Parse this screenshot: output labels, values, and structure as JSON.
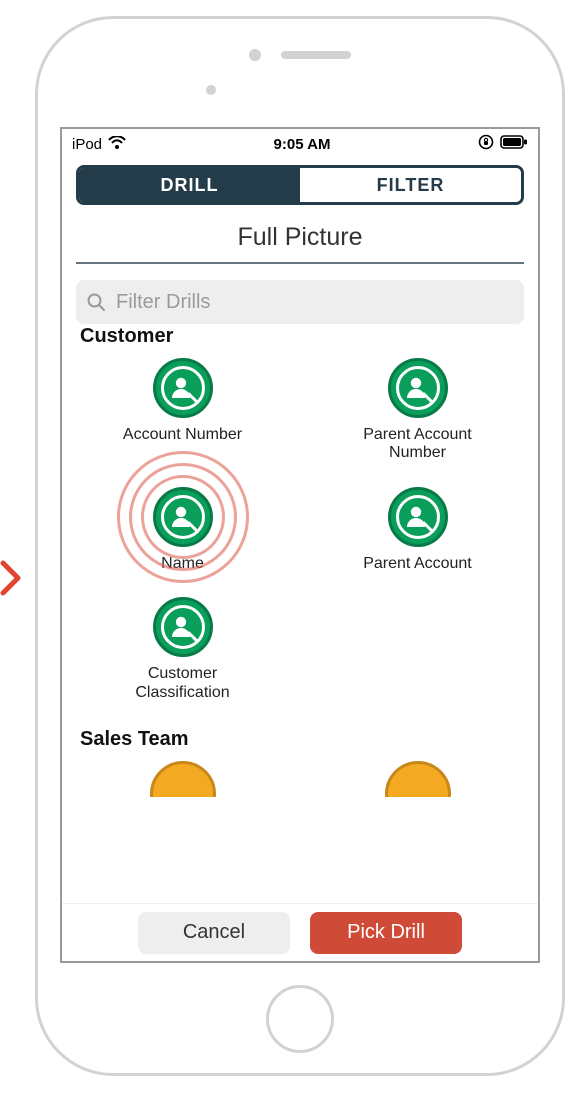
{
  "colors": {
    "dark_navy": "#243b4a",
    "accent_red": "#cf4b37",
    "customer_green": "#0a9e5b",
    "sales_orange": "#f3a922"
  },
  "statusbar": {
    "device": "iPod",
    "time": "9:05 AM"
  },
  "tabs": {
    "drill": "DRILL",
    "filter": "FILTER",
    "active": "drill"
  },
  "title": "Full Picture",
  "search": {
    "placeholder": "Filter Drills",
    "value": ""
  },
  "sections": {
    "customer": {
      "header": "Customer",
      "items": [
        {
          "id": "account-number",
          "label": "Account Number",
          "icon": "person-magnifier-icon",
          "highlighted": false
        },
        {
          "id": "parent-account-number",
          "label": "Parent Account Number",
          "icon": "person-magnifier-icon",
          "highlighted": false
        },
        {
          "id": "name",
          "label": "Name",
          "icon": "person-magnifier-icon",
          "highlighted": true
        },
        {
          "id": "parent-account",
          "label": "Parent Account",
          "icon": "person-magnifier-icon",
          "highlighted": false
        },
        {
          "id": "customer-classification",
          "label": "Customer Classification",
          "icon": "person-magnifier-icon",
          "highlighted": false
        }
      ]
    },
    "sales_team": {
      "header": "Sales Team"
    }
  },
  "footer": {
    "cancel": "Cancel",
    "pick": "Pick Drill"
  }
}
